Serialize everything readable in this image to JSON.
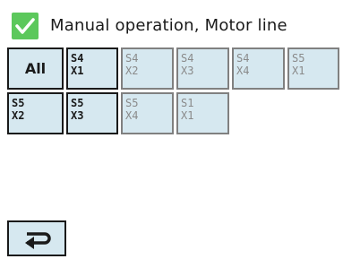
{
  "header": {
    "title": "Manual operation, Motor line",
    "check_icon": "check-icon",
    "check_color": "#5cc85c"
  },
  "grid": {
    "all_label": "All",
    "cells": [
      {
        "line1": "S4",
        "line2": "X1",
        "enabled": true
      },
      {
        "line1": "S4",
        "line2": "X2",
        "enabled": false
      },
      {
        "line1": "S4",
        "line2": "X3",
        "enabled": false
      },
      {
        "line1": "S4",
        "line2": "X4",
        "enabled": false
      },
      {
        "line1": "S5",
        "line2": "X1",
        "enabled": false
      },
      {
        "line1": "S5",
        "line2": "X2",
        "enabled": true
      },
      {
        "line1": "S5",
        "line2": "X3",
        "enabled": true
      },
      {
        "line1": "S5",
        "line2": "X4",
        "enabled": false
      },
      {
        "line1": "S1",
        "line2": "X1",
        "enabled": false
      }
    ]
  },
  "footer": {
    "back_icon": "return-arrow-icon"
  },
  "colors": {
    "button_fill": "#d6e8f0",
    "border_active": "#1a1a1a",
    "border_disabled": "#808080",
    "text_disabled": "#8a8a8a"
  }
}
